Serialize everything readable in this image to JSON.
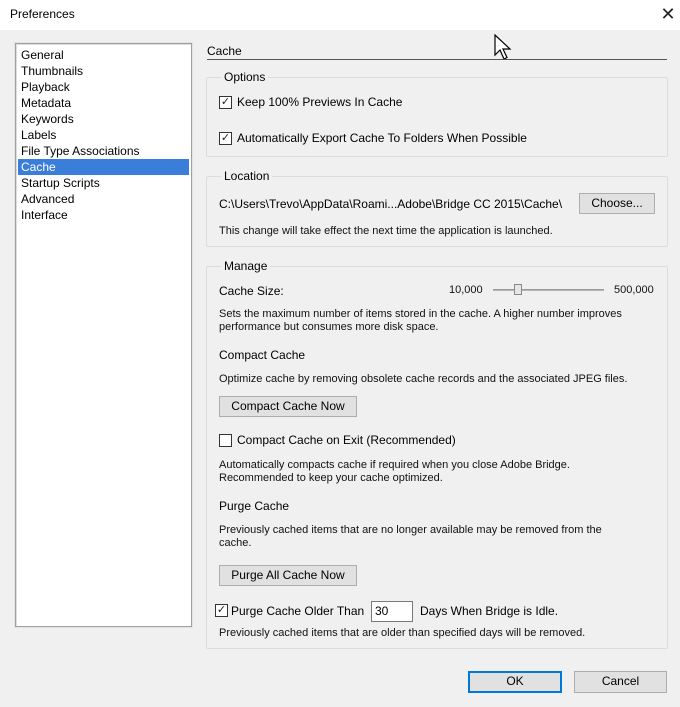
{
  "window": {
    "title": "Preferences"
  },
  "sidebar": {
    "items": [
      {
        "label": "General"
      },
      {
        "label": "Thumbnails"
      },
      {
        "label": "Playback"
      },
      {
        "label": "Metadata"
      },
      {
        "label": "Keywords"
      },
      {
        "label": "Labels"
      },
      {
        "label": "File Type Associations"
      },
      {
        "label": "Cache",
        "selected": true
      },
      {
        "label": "Startup Scripts"
      },
      {
        "label": "Advanced"
      },
      {
        "label": "Interface"
      }
    ]
  },
  "content": {
    "section_title": "Cache",
    "options": {
      "title": "Options",
      "keep_previews": {
        "label": "Keep 100% Previews In Cache",
        "checked": true
      },
      "auto_export": {
        "label": "Automatically Export Cache To Folders When Possible",
        "checked": true
      }
    },
    "location": {
      "title": "Location",
      "path": "C:\\Users\\Trevo\\AppData\\Roami...Adobe\\Bridge CC 2015\\Cache\\",
      "choose_button": "Choose...",
      "note": "This change will take effect the next time the application is launched."
    },
    "manage": {
      "title": "Manage",
      "cache_size_label": "Cache Size:",
      "cache_size_min": "10,000",
      "cache_size_max": "500,000",
      "cache_size_fraction": 0.2,
      "cache_size_desc_1": "Sets the maximum number of items stored in the cache. A higher number improves",
      "cache_size_desc_2": "performance but consumes more disk space.",
      "compact_heading": "Compact Cache",
      "compact_desc": "Optimize cache by removing obsolete cache records and the associated JPEG files.",
      "compact_button": "Compact Cache Now",
      "compact_on_exit": {
        "label": "Compact Cache on Exit (Recommended)",
        "checked": false
      },
      "compact_exit_desc_1": "Automatically compacts cache if required when you close Adobe Bridge.",
      "compact_exit_desc_2": "Recommended to keep your cache optimized.",
      "purge_heading": "Purge Cache",
      "purge_desc_1": "Previously cached items that are no longer available may be removed from the",
      "purge_desc_2": "cache.",
      "purge_button": "Purge All Cache Now",
      "purge_older": {
        "label": "Purge Cache Older Than",
        "checked": true,
        "days_value": "30",
        "days_suffix": "Days When Bridge is Idle."
      },
      "purge_older_desc": "Previously cached items that are older than specified days will be removed."
    }
  },
  "footer": {
    "ok_label": "OK",
    "cancel_label": "Cancel"
  },
  "check_glyph": "✓",
  "colors": {
    "selection": "#3b7ed9",
    "default_button_border": "#0078d7"
  }
}
